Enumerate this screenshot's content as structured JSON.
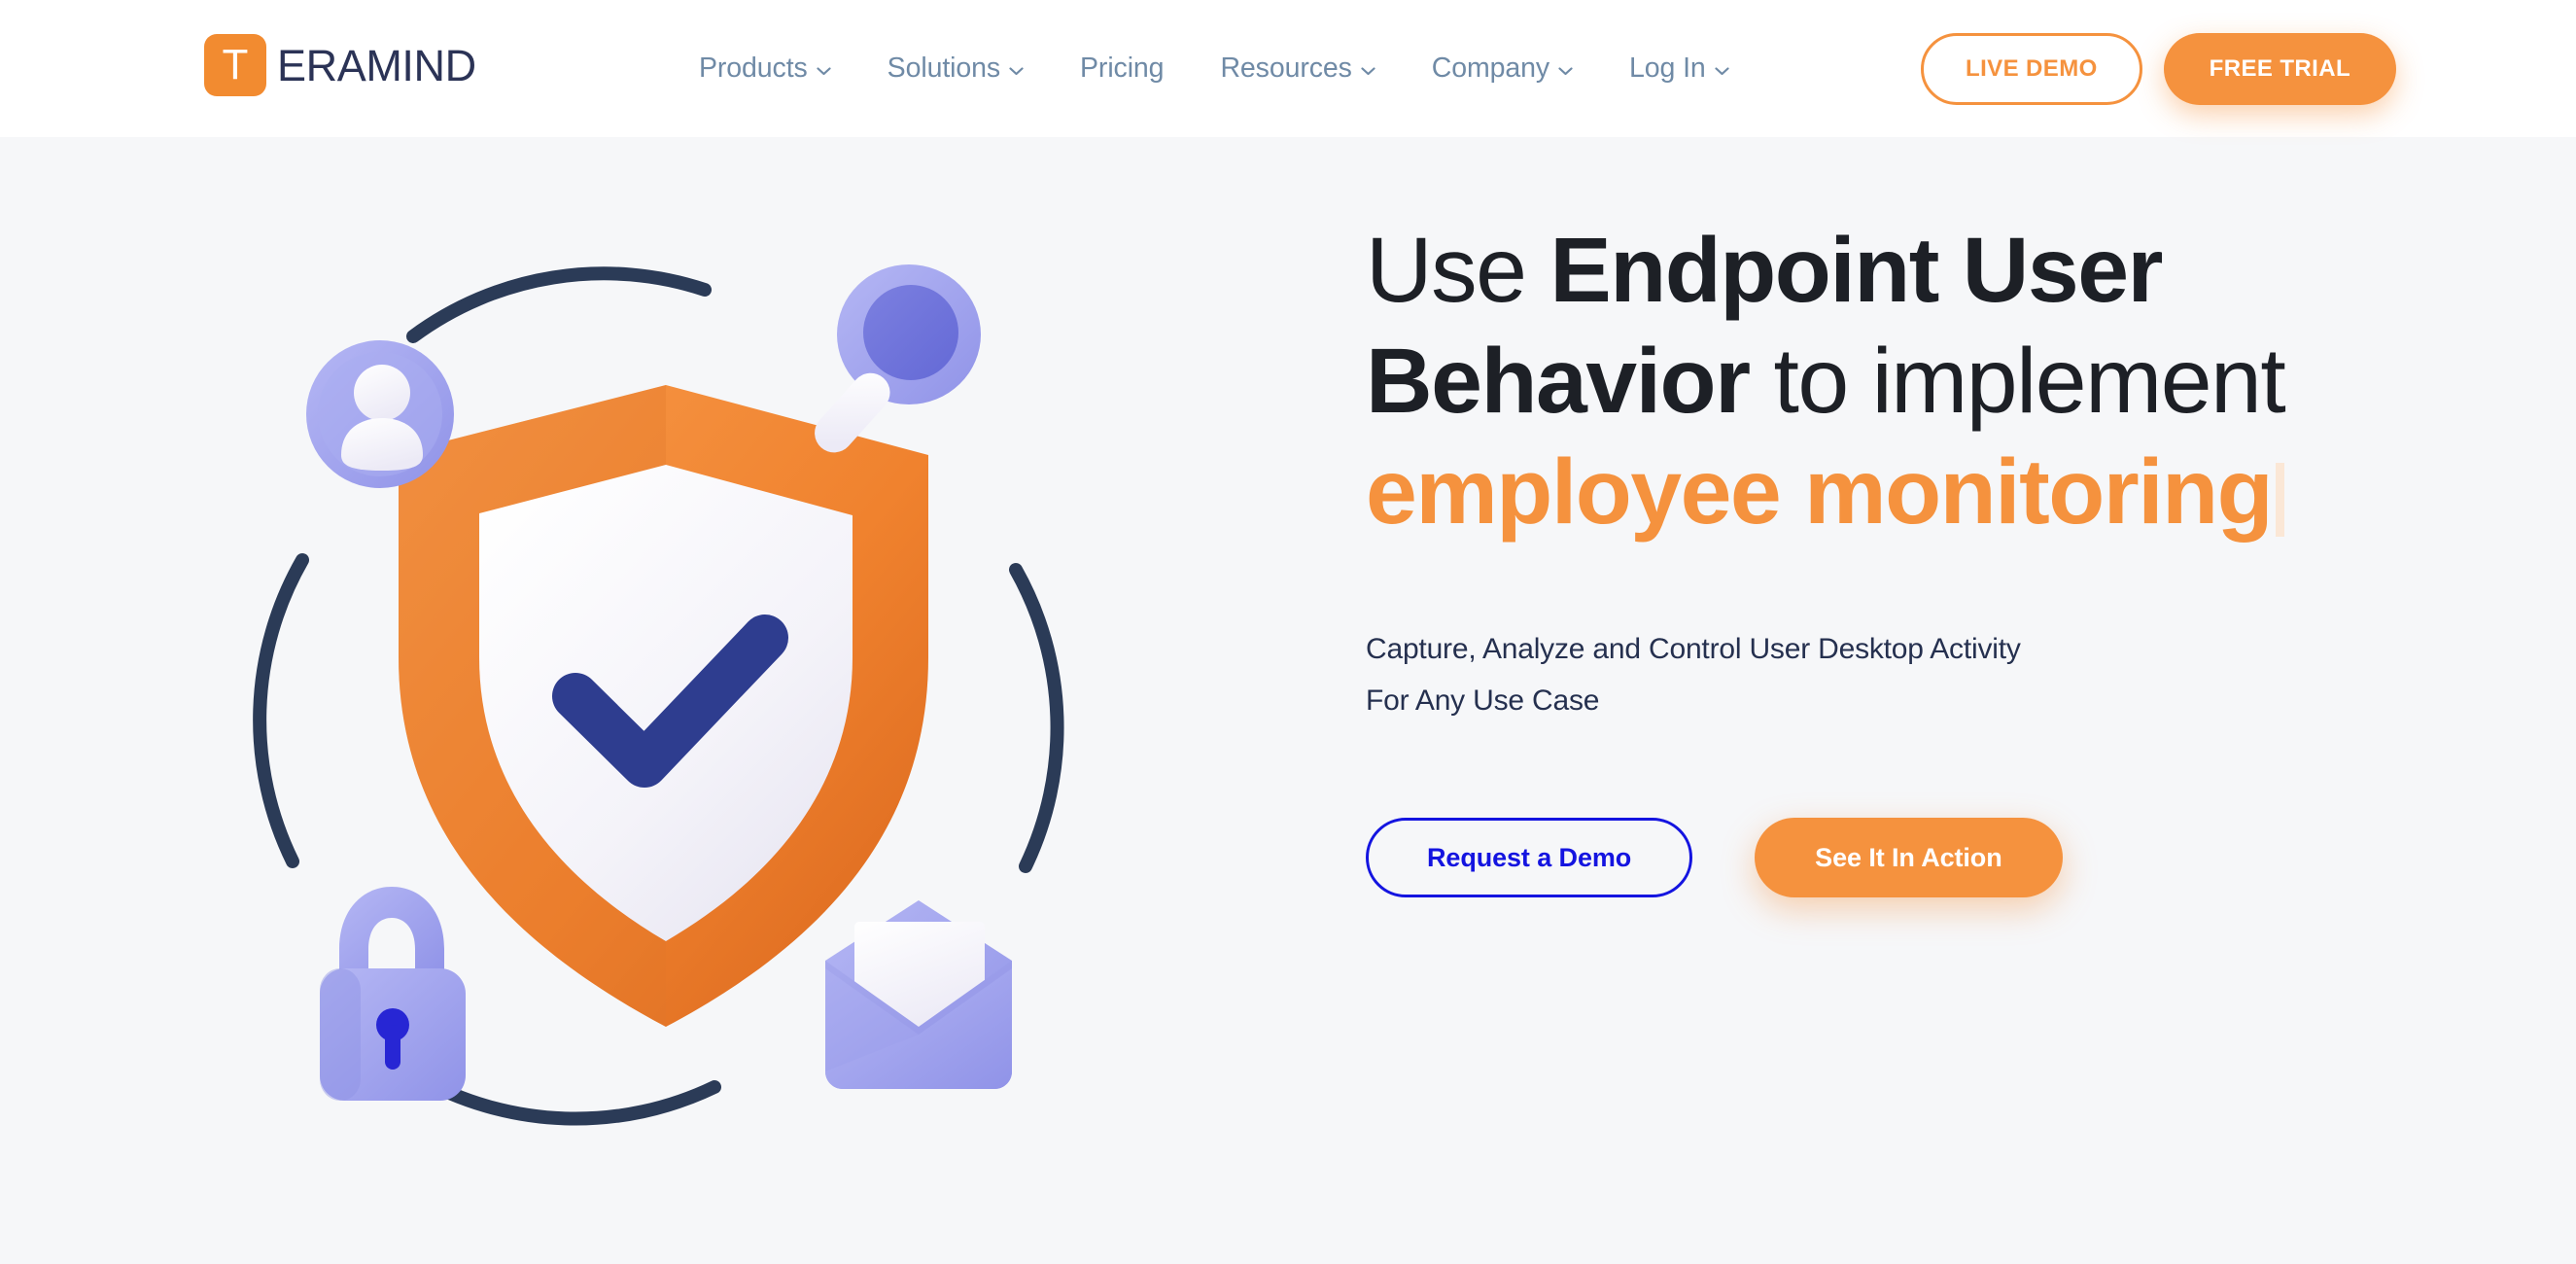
{
  "site": {
    "logo_mark_letter": "T",
    "logo_word": "ERAMIND",
    "brand_orange": "#f5923e",
    "brand_navy": "#2b3356",
    "nav_link_color": "#6f8aa6",
    "header_bg": "#ffffff",
    "hero_bg": "#f6f7f9"
  },
  "header": {
    "nav": [
      {
        "label": "Products",
        "has_chevron": true
      },
      {
        "label": "Solutions",
        "has_chevron": true
      },
      {
        "label": "Pricing",
        "has_chevron": false
      },
      {
        "label": "Resources",
        "has_chevron": true
      },
      {
        "label": "Company",
        "has_chevron": true
      },
      {
        "label": "Log In",
        "has_chevron": true
      }
    ],
    "live_demo_label": "LIVE DEMO",
    "free_trial_label": "FREE TRIAL"
  },
  "hero": {
    "headline": {
      "part1_light": "Use ",
      "part2_bold": "Endpoint User Behavior",
      "part3_light": " to implement ",
      "part4_orange": "employee monitoring"
    },
    "subtitle_line1": "Capture, Analyze and Control User Desktop Activity",
    "subtitle_line2": "For Any Use Case",
    "request_demo_label": "Request a Demo",
    "see_it_in_action_label": "See It In Action",
    "illustration": {
      "name": "security-shield-orbit-illustration",
      "center_icon": "shield-check-icon",
      "orbit_icons": [
        "user-avatar-icon",
        "magnifying-glass-icon",
        "padlock-icon",
        "envelope-icon"
      ],
      "shield_outer_color": "#f0822e",
      "shield_inner_color": "#f7f7fb",
      "check_color": "#2e3d8f",
      "accent_periwinkle": "#a5a8ef",
      "arc_color": "#2b3b57"
    }
  }
}
